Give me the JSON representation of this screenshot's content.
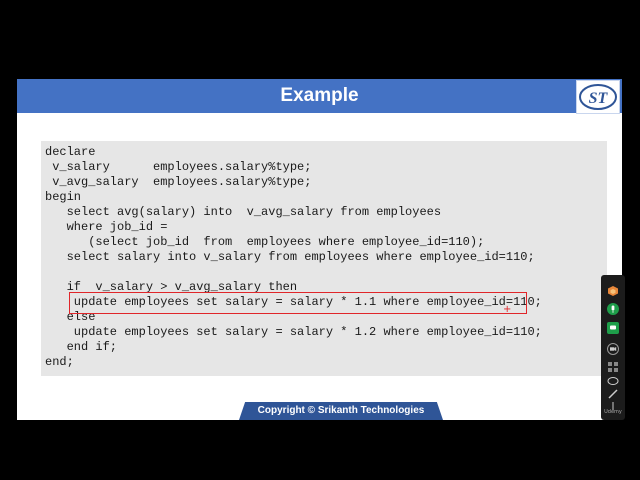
{
  "slide": {
    "title": "Example",
    "logo_text": "ST",
    "code_lines": [
      "declare",
      " v_salary      employees.salary%type;",
      " v_avg_salary  employees.salary%type;",
      "begin",
      "   select avg(salary) into  v_avg_salary from employees",
      "   where job_id =",
      "      (select job_id  from  employees where employee_id=110);",
      "   select salary into v_salary from employees where employee_id=110;",
      "",
      "   if  v_salary > v_avg_salary then",
      "    update employees set salary = salary * 1.1 where employee_id=110;",
      "   else",
      "    update employees set salary = salary * 1.2 where employee_id=110;",
      "   end if;",
      "end;"
    ],
    "highlighted_line_index": 10,
    "copyright": "Copyright © Srikanth Technologies"
  },
  "toolbar": {
    "label": "Udemy",
    "icons": [
      "cube-icon",
      "mic-icon",
      "chat-icon",
      "camera-icon",
      "grid-icon",
      "lasso-icon",
      "pen-icon",
      "pointer-icon"
    ]
  },
  "colors": {
    "title_bar": "#4472c4",
    "code_bg": "#e6e6e6",
    "highlight_border": "#e0262a",
    "copyright_bg": "#2f5597"
  }
}
